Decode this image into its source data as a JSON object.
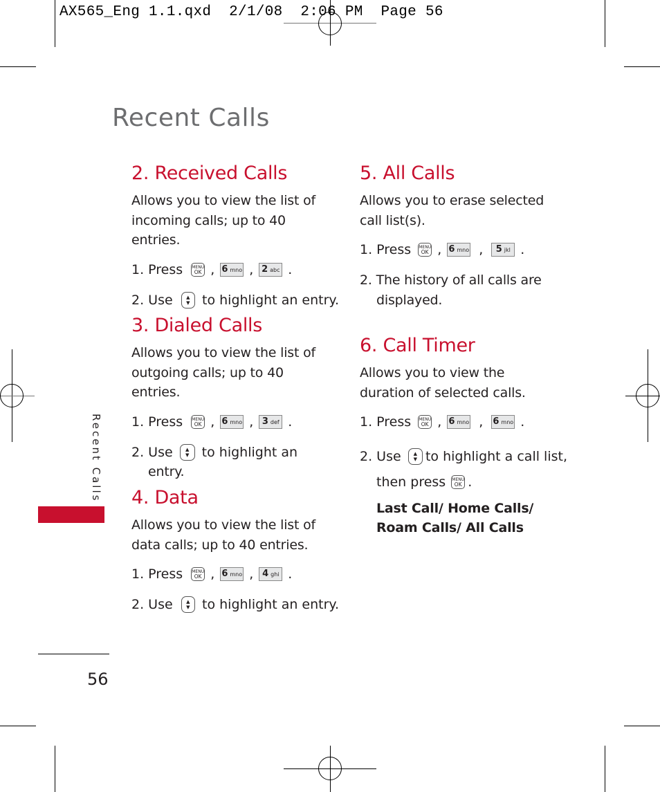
{
  "slug": "AX565_Eng 1.1.qxd  2/1/08  2:06 PM  Page 56",
  "page_title": "Recent Calls",
  "side_tab": "Recent Calls",
  "page_number": "56",
  "accent_color": "#c8102e",
  "sections": {
    "received": {
      "heading": "2. Received Calls",
      "description": "Allows you to view the list of incoming calls; up to 40 entries.",
      "step1_label": "1. Press",
      "step1_keys": [
        {
          "num": "6",
          "letters": "mno"
        },
        {
          "num": "2",
          "letters": "abc"
        }
      ],
      "step2_pre": "2. Use",
      "step2_post": "to highlight an entry."
    },
    "dialed": {
      "heading": "3. Dialed Calls",
      "description": "Allows you to view the list of outgoing calls; up to 40 entries.",
      "step1_label": "1. Press",
      "step1_keys": [
        {
          "num": "6",
          "letters": "mno"
        },
        {
          "num": "3",
          "letters": "def"
        }
      ],
      "step2_pre": "2.  Use",
      "step2_post": "to highlight an",
      "step2_cont": "entry."
    },
    "data": {
      "heading": "4. Data",
      "description": "Allows you to view the list of data calls; up to 40 entries.",
      "step1_label": "1. Press",
      "step1_keys": [
        {
          "num": "6",
          "letters": "mno"
        },
        {
          "num": "4",
          "letters": "ghi"
        }
      ],
      "step2_pre": "2. Use",
      "step2_post": "to highlight an entry."
    },
    "all": {
      "heading": "5. All Calls",
      "description": "Allows you to erase selected call list(s).",
      "step1_label": "1. Press",
      "step1_keys": [
        {
          "num": "6",
          "letters": "mno"
        },
        {
          "num": "5",
          "letters": "jkl"
        }
      ],
      "step2_line1": "2. The history of all calls are",
      "step2_line2": "displayed."
    },
    "timer": {
      "heading": "6. Call Timer",
      "description": "Allows you to view the duration of selected calls.",
      "step1_label": "1. Press",
      "step1_keys": [
        {
          "num": "6",
          "letters": "mno"
        },
        {
          "num": "6",
          "letters": "mno"
        }
      ],
      "step2_pre": "2. Use",
      "step2_post": "to highlight a call list,",
      "step2_cont_pre": "then press",
      "options": "Last Call/ Home Calls/ Roam Calls/ All Calls"
    }
  },
  "keys": {
    "menu_top": "MENU",
    "menu_bottom": "OK",
    "nav_up": "▲",
    "nav_down": "▼",
    "comma": ",",
    "period": "."
  }
}
